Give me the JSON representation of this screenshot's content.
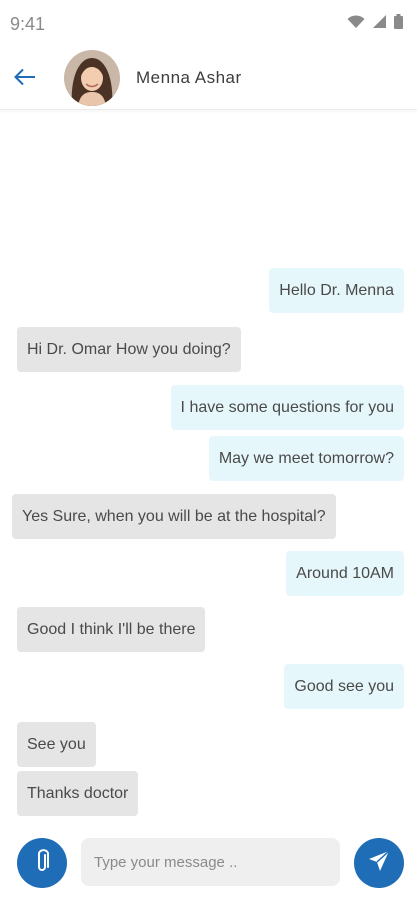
{
  "status_bar": {
    "time": "9:41",
    "icons": [
      "wifi-icon",
      "signal-icon",
      "battery-icon"
    ]
  },
  "header": {
    "back_icon": "arrow-left-icon",
    "contact_name": "Menna Ashar",
    "avatar": "contact-avatar"
  },
  "messages": [
    {
      "direction": "sent",
      "text": "Hello Dr. Menna"
    },
    {
      "direction": "received",
      "text": "Hi Dr. Omar How you doing?"
    },
    {
      "direction": "sent",
      "text": "I have some questions for you"
    },
    {
      "direction": "sent",
      "text": "May we meet tomorrow?"
    },
    {
      "direction": "received",
      "text": "Yes Sure, when you will be at the hospital?"
    },
    {
      "direction": "sent",
      "text": "Around 10AM"
    },
    {
      "direction": "received",
      "text": "Good I think I'll be there"
    },
    {
      "direction": "sent",
      "text": "Good see you"
    },
    {
      "direction": "received",
      "text": "See you"
    },
    {
      "direction": "received",
      "text": "Thanks doctor"
    }
  ],
  "composer": {
    "placeholder": "Type your message ..",
    "attach_icon": "paperclip-icon",
    "send_icon": "send-icon"
  },
  "colors": {
    "accent": "#1e6db6",
    "sent_bubble": "#e6f7fb",
    "received_bubble": "#e5e5e5"
  }
}
